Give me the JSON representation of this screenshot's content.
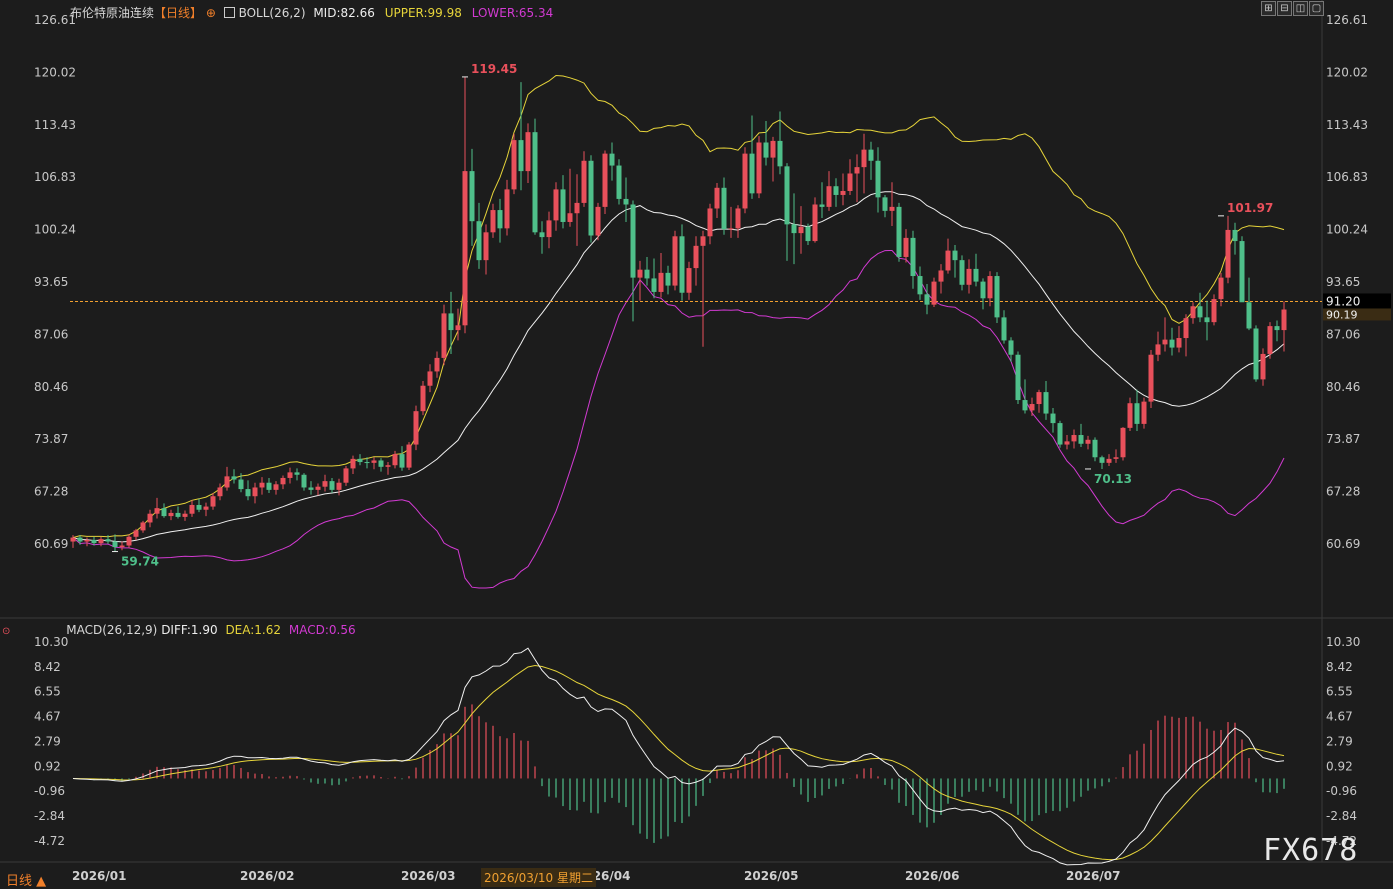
{
  "header": {
    "instrument": "布伦特原油连续",
    "period_tag": "【日线】",
    "indicator": "BOLL(26,2)",
    "mid": "MID:82.66",
    "upper": "UPPER:99.98",
    "lower": "LOWER:65.34"
  },
  "macd_header": {
    "indicator": "MACD(26,12,9)",
    "diff": "DIFF:1.90",
    "dea": "DEA:1.62",
    "macd": "MACD:0.56"
  },
  "toolbar": {
    "buttons": [
      "⊞",
      "⊟",
      "◫",
      "▢"
    ]
  },
  "bottom_bar": {
    "period_label": "日线 ▲",
    "crosshair_date": "2026/03/10 星期二"
  },
  "watermark": "FX678",
  "price_line": {
    "value": "91.20",
    "overlay_value": "90.19"
  },
  "colors": {
    "up": "#e8505b",
    "down": "#4fbf8a",
    "mid_line": "#f0f0f0",
    "upper_line": "#e6d43a",
    "lower_line": "#d23ad2",
    "dea_line": "#e6d43a",
    "price_line": "#f0a030",
    "label_upper": "#e6d43a",
    "label_lower": "#d23ad2"
  },
  "chart_data": [
    {
      "type": "candlestick",
      "x_ticks": [
        "2026/01",
        "2026/02",
        "2026/03",
        "2026/04",
        "2026/05",
        "2026/06",
        "2026/07"
      ],
      "y_ticks": [
        60.69,
        67.28,
        73.87,
        80.46,
        87.06,
        93.65,
        100.24,
        106.83,
        113.43,
        120.02,
        126.61
      ],
      "ylim": [
        57.0,
        126.61
      ],
      "annotations": [
        {
          "text": "119.45",
          "value": 119.45,
          "x_index": 56
        },
        {
          "text": "59.74",
          "value": 59.74,
          "x_index": 6
        },
        {
          "text": "70.13",
          "value": 70.13,
          "x_index": 145
        },
        {
          "text": "101.97",
          "value": 101.97,
          "x_index": 164
        }
      ],
      "ohlc": [
        [
          61.0,
          61.8,
          60.2,
          61.5
        ],
        [
          61.5,
          61.8,
          60.6,
          61.0
        ],
        [
          61.0,
          61.5,
          60.4,
          61.2
        ],
        [
          61.2,
          61.6,
          60.5,
          60.8
        ],
        [
          60.8,
          61.6,
          60.4,
          61.3
        ],
        [
          61.3,
          61.8,
          60.7,
          61.0
        ],
        [
          61.0,
          61.9,
          59.74,
          60.3
        ],
        [
          60.3,
          61.0,
          59.9,
          60.5
        ],
        [
          60.5,
          61.9,
          60.2,
          61.6
        ],
        [
          61.6,
          62.6,
          61.2,
          62.4
        ],
        [
          62.4,
          63.6,
          62.1,
          63.4
        ],
        [
          63.4,
          65.0,
          62.8,
          64.5
        ],
        [
          64.5,
          66.5,
          63.9,
          65.2
        ],
        [
          65.2,
          65.8,
          64.0,
          64.2
        ],
        [
          64.2,
          65.0,
          63.7,
          64.6
        ],
        [
          64.6,
          65.4,
          63.9,
          64.1
        ],
        [
          64.1,
          64.9,
          63.6,
          64.5
        ],
        [
          64.5,
          66.2,
          64.1,
          65.6
        ],
        [
          65.6,
          66.4,
          64.7,
          65.0
        ],
        [
          65.0,
          65.9,
          64.2,
          65.4
        ],
        [
          65.4,
          67.1,
          65.0,
          66.7
        ],
        [
          66.7,
          68.3,
          66.2,
          67.8
        ],
        [
          67.8,
          70.4,
          67.4,
          69.2
        ],
        [
          69.2,
          70.1,
          68.3,
          68.8
        ],
        [
          68.8,
          69.6,
          67.2,
          67.6
        ],
        [
          67.6,
          68.7,
          66.2,
          66.7
        ],
        [
          66.7,
          68.4,
          65.8,
          67.8
        ],
        [
          67.8,
          69.1,
          66.9,
          68.4
        ],
        [
          68.4,
          69.0,
          67.1,
          67.5
        ],
        [
          67.5,
          68.6,
          66.9,
          68.2
        ],
        [
          68.2,
          69.3,
          67.6,
          69.0
        ],
        [
          69.0,
          70.3,
          68.3,
          69.7
        ],
        [
          69.7,
          70.2,
          68.7,
          69.4
        ],
        [
          69.4,
          69.6,
          67.4,
          67.8
        ],
        [
          67.8,
          68.6,
          66.9,
          67.5
        ],
        [
          67.5,
          68.3,
          66.8,
          67.9
        ],
        [
          67.9,
          69.4,
          67.3,
          68.6
        ],
        [
          68.6,
          69.0,
          67.1,
          67.5
        ],
        [
          67.5,
          68.9,
          66.8,
          68.4
        ],
        [
          68.4,
          70.5,
          68.0,
          70.2
        ],
        [
          70.2,
          71.8,
          69.5,
          71.4
        ],
        [
          71.4,
          72.0,
          70.6,
          71.0
        ],
        [
          71.0,
          71.6,
          70.2,
          70.9
        ],
        [
          70.9,
          71.6,
          70.1,
          71.2
        ],
        [
          71.2,
          71.5,
          69.8,
          70.4
        ],
        [
          70.4,
          71.0,
          69.4,
          70.6
        ],
        [
          70.6,
          72.4,
          70.2,
          72.0
        ],
        [
          72.0,
          73.0,
          69.9,
          70.3
        ],
        [
          70.3,
          73.5,
          70.0,
          73.2
        ],
        [
          73.2,
          78.1,
          72.5,
          77.4
        ],
        [
          77.4,
          81.2,
          76.9,
          80.6
        ],
        [
          80.6,
          83.3,
          79.8,
          82.4
        ],
        [
          82.4,
          84.9,
          81.6,
          84.1
        ],
        [
          84.1,
          90.8,
          83.2,
          89.7
        ],
        [
          89.7,
          92.4,
          84.6,
          87.6
        ],
        [
          87.6,
          90.3,
          86.3,
          88.2
        ],
        [
          88.2,
          119.45,
          87.2,
          107.6
        ],
        [
          107.6,
          110.4,
          98.2,
          101.3
        ],
        [
          101.3,
          103.6,
          95.3,
          96.4
        ],
        [
          96.4,
          100.9,
          94.6,
          99.9
        ],
        [
          99.9,
          103.5,
          99.2,
          102.7
        ],
        [
          102.7,
          104.1,
          98.6,
          100.4
        ],
        [
          100.4,
          106.5,
          99.5,
          105.3
        ],
        [
          105.3,
          112.3,
          104.7,
          111.5
        ],
        [
          111.5,
          118.8,
          105.2,
          107.6
        ],
        [
          107.6,
          113.6,
          106.1,
          112.5
        ],
        [
          112.5,
          114.2,
          99.6,
          99.9
        ],
        [
          99.9,
          101.3,
          97.2,
          99.3
        ],
        [
          99.3,
          102.5,
          97.9,
          101.4
        ],
        [
          101.4,
          106.2,
          100.1,
          105.3
        ],
        [
          105.3,
          107.1,
          100.4,
          101.2
        ],
        [
          101.2,
          107.9,
          100.6,
          102.3
        ],
        [
          102.3,
          107.2,
          98.2,
          103.6
        ],
        [
          103.6,
          110.1,
          103.1,
          108.9
        ],
        [
          108.9,
          109.6,
          98.6,
          99.5
        ],
        [
          99.5,
          103.6,
          98.9,
          103.1
        ],
        [
          103.1,
          110.2,
          102.2,
          109.8
        ],
        [
          109.8,
          111.2,
          106.4,
          108.3
        ],
        [
          108.3,
          109.1,
          103.4,
          104.1
        ],
        [
          104.1,
          106.8,
          101.2,
          103.4
        ],
        [
          103.4,
          103.9,
          88.7,
          94.2
        ],
        [
          94.2,
          96.3,
          91.3,
          95.2
        ],
        [
          95.2,
          96.8,
          93.2,
          94.1
        ],
        [
          94.1,
          96.6,
          91.6,
          92.4
        ],
        [
          92.4,
          97.3,
          91.7,
          94.8
        ],
        [
          94.8,
          95.7,
          92.1,
          93.2
        ],
        [
          93.2,
          100.1,
          92.6,
          99.4
        ],
        [
          99.4,
          100.9,
          91.3,
          92.3
        ],
        [
          92.3,
          96.2,
          91.4,
          95.4
        ],
        [
          95.4,
          99.4,
          93.2,
          98.2
        ],
        [
          98.2,
          100.1,
          85.5,
          99.4
        ],
        [
          99.4,
          103.5,
          98.4,
          102.9
        ],
        [
          102.9,
          106.1,
          101.7,
          105.5
        ],
        [
          105.5,
          106.8,
          99.6,
          100.3
        ],
        [
          100.3,
          103.1,
          99.2,
          100.4
        ],
        [
          100.4,
          103.3,
          99.2,
          102.9
        ],
        [
          102.9,
          110.6,
          102.3,
          109.8
        ],
        [
          109.8,
          114.6,
          104.1,
          104.8
        ],
        [
          104.8,
          112.0,
          104.2,
          111.2
        ],
        [
          111.2,
          113.9,
          108.3,
          109.3
        ],
        [
          109.3,
          111.9,
          106.3,
          111.4
        ],
        [
          111.4,
          115.1,
          107.2,
          108.2
        ],
        [
          108.2,
          108.6,
          96.3,
          100.9
        ],
        [
          100.9,
          104.8,
          95.9,
          99.8
        ],
        [
          99.8,
          103.2,
          97.2,
          100.6
        ],
        [
          100.6,
          101.0,
          98.3,
          98.8
        ],
        [
          98.8,
          104.3,
          98.6,
          103.4
        ],
        [
          103.4,
          106.2,
          101.7,
          103.1
        ],
        [
          103.1,
          107.6,
          102.6,
          105.7
        ],
        [
          105.7,
          106.7,
          103.1,
          104.6
        ],
        [
          104.6,
          107.3,
          103.3,
          105.1
        ],
        [
          105.1,
          109.1,
          104.6,
          107.3
        ],
        [
          107.3,
          109.7,
          103.7,
          108.1
        ],
        [
          108.1,
          112.3,
          104.8,
          110.3
        ],
        [
          110.3,
          111.3,
          106.5,
          108.9
        ],
        [
          108.9,
          110.6,
          102.4,
          104.3
        ],
        [
          104.3,
          104.6,
          101.8,
          102.6
        ],
        [
          102.6,
          106.2,
          100.7,
          103.1
        ],
        [
          103.1,
          103.6,
          96.2,
          96.8
        ],
        [
          96.8,
          100.3,
          96.1,
          99.2
        ],
        [
          99.2,
          100.1,
          92.8,
          94.4
        ],
        [
          94.4,
          95.6,
          91.4,
          92.1
        ],
        [
          92.1,
          93.4,
          89.6,
          90.8
        ],
        [
          90.8,
          94.2,
          90.5,
          93.7
        ],
        [
          93.7,
          95.9,
          92.2,
          95.1
        ],
        [
          95.1,
          99.1,
          94.7,
          97.6
        ],
        [
          97.6,
          98.3,
          94.2,
          96.4
        ],
        [
          96.4,
          97.0,
          92.6,
          93.3
        ],
        [
          93.3,
          96.5,
          92.2,
          95.3
        ],
        [
          95.3,
          97.2,
          93.1,
          93.7
        ],
        [
          93.7,
          94.1,
          90.2,
          91.6
        ],
        [
          91.6,
          95.0,
          90.6,
          94.4
        ],
        [
          94.4,
          94.9,
          88.5,
          89.2
        ],
        [
          89.2,
          90.1,
          85.9,
          86.3
        ],
        [
          86.3,
          86.7,
          83.6,
          84.5
        ],
        [
          84.5,
          84.9,
          78.3,
          78.8
        ],
        [
          78.8,
          81.4,
          77.1,
          77.5
        ],
        [
          77.5,
          79.1,
          76.8,
          78.3
        ],
        [
          78.3,
          80.1,
          77.2,
          79.8
        ],
        [
          79.8,
          81.2,
          76.3,
          77.1
        ],
        [
          77.1,
          77.8,
          74.7,
          75.9
        ],
        [
          75.9,
          76.2,
          72.8,
          73.2
        ],
        [
          73.2,
          74.4,
          72.6,
          73.6
        ],
        [
          73.6,
          75.1,
          72.7,
          74.4
        ],
        [
          74.4,
          75.8,
          72.9,
          73.3
        ],
        [
          73.3,
          74.3,
          72.6,
          73.8
        ],
        [
          73.8,
          74.1,
          71.1,
          71.6
        ],
        [
          71.6,
          71.8,
          70.13,
          70.9
        ],
        [
          70.9,
          72.0,
          70.5,
          71.4
        ],
        [
          71.4,
          72.6,
          70.9,
          71.6
        ],
        [
          71.6,
          75.4,
          71.2,
          75.3
        ],
        [
          75.3,
          79.1,
          74.9,
          78.4
        ],
        [
          78.4,
          80.1,
          74.9,
          75.8
        ],
        [
          75.8,
          79.1,
          75.2,
          78.6
        ],
        [
          78.6,
          85.1,
          77.8,
          84.5
        ],
        [
          84.5,
          87.4,
          83.7,
          85.8
        ],
        [
          85.8,
          89.2,
          84.9,
          86.4
        ],
        [
          86.4,
          87.9,
          84.4,
          85.4
        ],
        [
          85.4,
          88.1,
          84.8,
          86.6
        ],
        [
          86.6,
          89.6,
          84.3,
          89.1
        ],
        [
          89.1,
          91.1,
          88.4,
          90.6
        ],
        [
          90.6,
          92.3,
          88.6,
          89.2
        ],
        [
          89.2,
          91.3,
          86.3,
          88.6
        ],
        [
          88.6,
          92.1,
          88.2,
          91.5
        ],
        [
          91.5,
          94.8,
          90.6,
          94.2
        ],
        [
          94.2,
          101.97,
          93.5,
          100.2
        ],
        [
          100.2,
          101.1,
          97.1,
          98.8
        ],
        [
          98.8,
          99.4,
          93.7,
          91.1
        ],
        [
          91.1,
          94.2,
          87.6,
          87.8
        ],
        [
          87.8,
          88.2,
          81.1,
          81.4
        ],
        [
          81.4,
          85.3,
          80.6,
          84.6
        ],
        [
          84.6,
          88.6,
          84.0,
          88.1
        ],
        [
          88.1,
          88.8,
          86.2,
          87.6
        ],
        [
          87.6,
          91.2,
          84.9,
          90.19
        ]
      ],
      "bollinger": {
        "period": 26,
        "mid_last": 82.66,
        "upper_last": 99.98,
        "lower_last": 65.34
      }
    },
    {
      "type": "bar",
      "title": "MACD(26,12,9)",
      "x_ticks": [
        "2026/01",
        "2026/02",
        "2026/03",
        "2026/04",
        "2026/05",
        "2026/06",
        "2026/07"
      ],
      "y_ticks": [
        -4.72,
        -2.84,
        -0.96,
        0.92,
        2.79,
        4.67,
        6.55,
        8.42,
        10.3
      ],
      "ylim": [
        -6.5,
        10.3
      ],
      "series": [
        {
          "name": "DIFF",
          "value_last": 1.9
        },
        {
          "name": "DEA",
          "value_last": 1.62
        },
        {
          "name": "MACD",
          "value_last": 0.56
        }
      ]
    }
  ]
}
